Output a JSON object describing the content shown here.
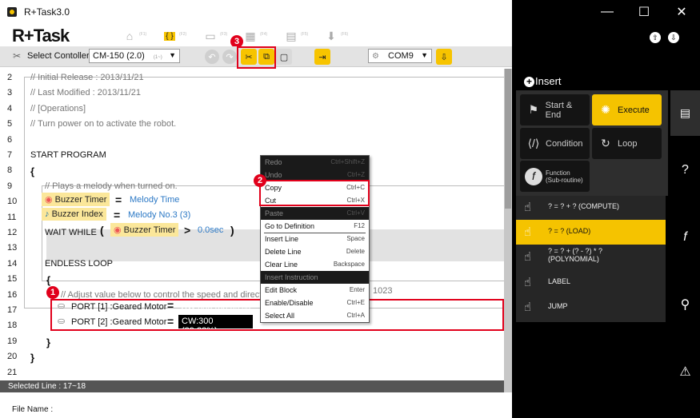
{
  "window": {
    "title": "R+Task3.0",
    "controls": [
      "—",
      "☐",
      "✕"
    ]
  },
  "toolbar": {
    "logo": "R+Task",
    "icon_labels": [
      "(F1)",
      "(F2)",
      "(F3)",
      "(F4)",
      "(F5)",
      "(F6)"
    ]
  },
  "toolbar2": {
    "select_controller_label": "Select Contoller",
    "controller_value": "CM-150 (2.0)",
    "controller_hint": "(1~)",
    "port_value": "COM9"
  },
  "lines": [
    {
      "n": "2",
      "text": "//   Initial Release : 2013/11/21"
    },
    {
      "n": "3",
      "text": "//   Last Modified : 2013/11/21"
    },
    {
      "n": "4",
      "text": "//   [Operations]"
    },
    {
      "n": "5",
      "text": "//   Turn power on to activate the robot."
    },
    {
      "n": "6",
      "text": ""
    },
    {
      "n": "7",
      "text": "START PROGRAM"
    },
    {
      "n": "8",
      "text": "{"
    },
    {
      "n": "9",
      "text": "//   Plays a melody when turned on."
    },
    {
      "n": "10",
      "text": ""
    },
    {
      "n": "11",
      "text": ""
    },
    {
      "n": "12",
      "text": "WAIT WHILE"
    },
    {
      "n": "13",
      "text": ""
    },
    {
      "n": "14",
      "text": "ENDLESS LOOP"
    },
    {
      "n": "15",
      "text": "{"
    },
    {
      "n": "16",
      "text": "//   Adjust value below to control the speed and direction"
    },
    {
      "n": "17",
      "text": ""
    },
    {
      "n": "18",
      "text": ""
    },
    {
      "n": "19",
      "text": "}"
    },
    {
      "n": "20",
      "text": "}"
    },
    {
      "n": "21",
      "text": ""
    }
  ],
  "code": {
    "buzzer_timer": "Buzzer Timer",
    "melody_time": "Melody Time",
    "buzzer_index": "Buzzer Index",
    "melody_no": "Melody No.3 (3)",
    "eq": "=",
    "gt": ">",
    "wait_val": "0.0sec",
    "paren_open": "(",
    "paren_close": ")",
    "comment16_tail": "1023",
    "port1": "PORT [1] :Geared Motor",
    "port2": "PORT [2] :Geared Motor",
    "port1_val": "CW:850 (83.09%)",
    "port2_val": "CW:300 (29.33%)"
  },
  "context_menu": [
    {
      "label": "Redo",
      "shortcut": "Ctrl+Shift+Z",
      "disabled": true
    },
    {
      "label": "Undo",
      "shortcut": "Ctrl+Z",
      "disabled": true
    },
    {
      "label": "Copy",
      "shortcut": "Ctrl+C",
      "disabled": false
    },
    {
      "label": "Cut",
      "shortcut": "Ctrl+X",
      "disabled": false
    },
    {
      "label": "Paste",
      "shortcut": "Ctrl+V",
      "disabled": true
    },
    {
      "label": "Go to Definition",
      "shortcut": "F12",
      "disabled": false
    },
    {
      "label": "Insert Line",
      "shortcut": "Space",
      "disabled": false
    },
    {
      "label": "Delete Line",
      "shortcut": "Delete",
      "disabled": false
    },
    {
      "label": "Clear Line",
      "shortcut": "Backspace",
      "disabled": false
    },
    {
      "label": "Insert Instruction",
      "shortcut": "",
      "disabled": true
    },
    {
      "label": "Edit Block",
      "shortcut": "Enter",
      "disabled": false
    },
    {
      "label": "Enable/Disable",
      "shortcut": "Ctrl+E",
      "disabled": false
    },
    {
      "label": "Select All",
      "shortcut": "Ctrl+A",
      "disabled": false
    }
  ],
  "badges": [
    "1",
    "2",
    "3"
  ],
  "status": {
    "selected": "Selected Line : 17~18",
    "file": "File Name :"
  },
  "right_panel": {
    "insert": "Insert",
    "buttons": [
      "Start & End",
      "Execute",
      "Condition",
      "Loop",
      "Function\n(Sub-routine)"
    ],
    "list": [
      "? = ? + ?  (COMPUTE)",
      "? = ?  (LOAD)",
      "? = ? + (? - ?) * ?\n(POLYNOMIAL)",
      "LABEL",
      "JUMP"
    ],
    "side_tabs": [
      "?",
      "f",
      "⚲",
      "⚠"
    ]
  },
  "colors": {
    "accent_yellow": "#f5c300",
    "highlight_red": "#e1001b",
    "blue_value": "#2b78c5"
  }
}
